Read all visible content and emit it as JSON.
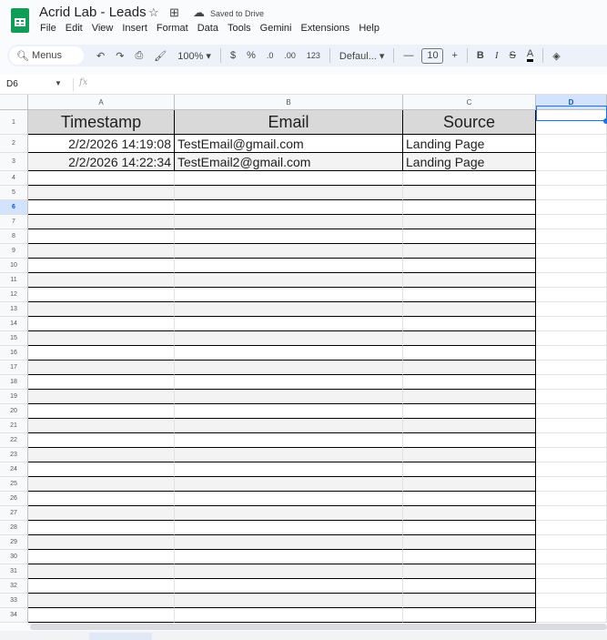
{
  "app": {
    "title": "Acrid Lab - Leads",
    "save_status": "Saved to Drive"
  },
  "menu": [
    "File",
    "Edit",
    "View",
    "Insert",
    "Format",
    "Data",
    "Tools",
    "Gemini",
    "Extensions",
    "Help"
  ],
  "toolbar": {
    "search_label": "Menus",
    "zoom": "100%",
    "currency": "$",
    "percent": "%",
    "dec_decrease": ".0",
    "dec_increase": ".00",
    "number_format": "123",
    "font": "Defaul...",
    "font_size": "10",
    "bold": "B",
    "italic": "I",
    "strike": "S",
    "text_color": "A"
  },
  "formula_bar": {
    "name_box": "D6",
    "fx": "fx",
    "value": ""
  },
  "columns": [
    "A",
    "B",
    "C",
    "D"
  ],
  "header": [
    "Timestamp",
    "Email",
    "Source"
  ],
  "rows": [
    [
      "2/2/2026 14:19:08",
      "TestEmail@gmail.com",
      "Landing Page"
    ],
    [
      "2/2/2026 14:22:34",
      "TestEmail2@gmail.com",
      "Landing Page"
    ]
  ],
  "visible_row_count": 34,
  "selected_cell": "D6",
  "colors": {
    "accent": "#1a73e8",
    "header_fill": "#d9d9d9",
    "band": "#f3f3f3",
    "sheets_green": "#0f9d58"
  }
}
